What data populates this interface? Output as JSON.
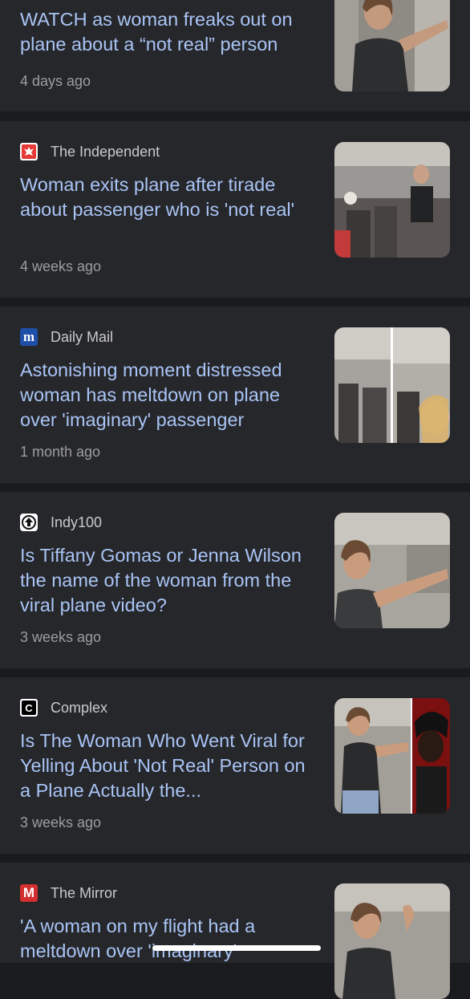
{
  "articles": [
    {
      "headline": "WATCH as woman freaks out on plane about a “not real” person",
      "time": "4 days ago",
      "thumbnail": "woman-on-plane-photo"
    },
    {
      "source": "The Independent",
      "source_icon": "eagle-logo-icon",
      "source_color": "#e53935",
      "headline": "Woman exits plane after tirade about passenger who is 'not real'",
      "time": "4 weeks ago",
      "thumbnail": "plane-aisle-photo"
    },
    {
      "source": "Daily Mail",
      "source_icon": "daily-mail-logo-icon",
      "source_color": "#1e4fa8",
      "source_glyph": "m",
      "headline": "Astonishing moment distressed woman has meltdown on plane over 'imaginary' passenger",
      "time": "1 month ago",
      "thumbnail": "split-plane-photo"
    },
    {
      "source": "Indy100",
      "source_icon": "indy100-logo-icon",
      "source_color": "#ffffff",
      "headline": "Is Tiffany Gomas or Jenna Wilson the name of the woman from the viral plane video?",
      "time": "3 weeks ago",
      "thumbnail": "woman-pointing-photo"
    },
    {
      "source": "Complex",
      "source_icon": "complex-logo-icon",
      "source_color": "#000000",
      "source_glyph": "C",
      "headline": "Is The Woman Who Went Viral for Yelling About 'Not Real' Person on a Plane Actually the...",
      "time": "3 weeks ago",
      "thumbnail": "woman-and-rapper-photo"
    },
    {
      "source": "The Mirror",
      "source_icon": "mirror-logo-icon",
      "source_color": "#d32f2f",
      "source_glyph": "M",
      "headline": "'A woman on my flight had a meltdown over 'imaginary'",
      "time": "",
      "thumbnail": "woman-on-plane-photo-2"
    }
  ]
}
